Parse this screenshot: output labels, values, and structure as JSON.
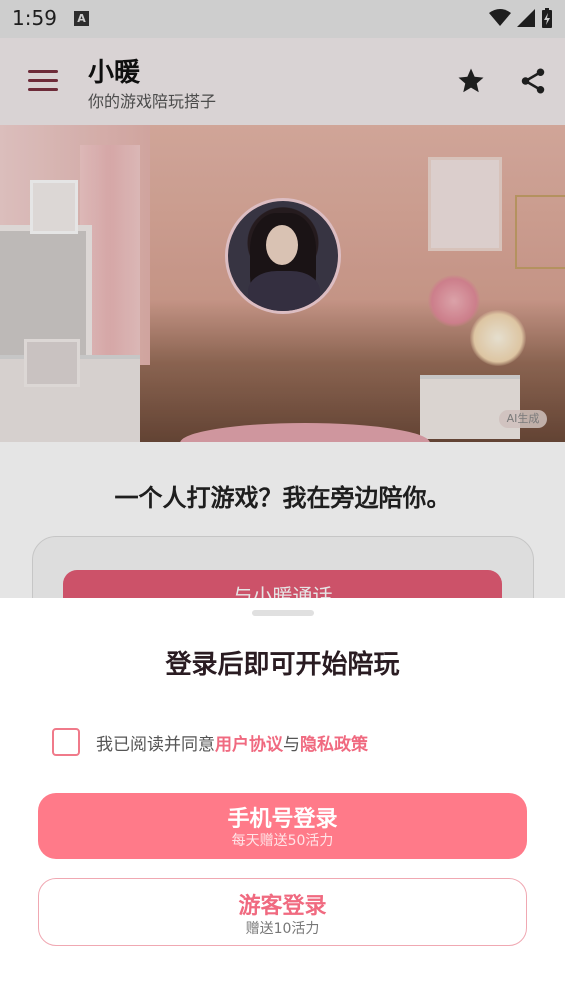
{
  "status_bar": {
    "time": "1:59",
    "notification_icon": "A"
  },
  "app_bar": {
    "title": "小暖",
    "subtitle": "你的游戏陪玩搭子"
  },
  "hero": {
    "ai_badge": "AI生成"
  },
  "main": {
    "headline": "一个人打游戏？我在旁边陪你。",
    "call_button_label": "与小暖通话"
  },
  "login_sheet": {
    "title": "登录后即可开始陪玩",
    "agreement": {
      "prefix": "我已阅读并同意",
      "user_agreement": "用户协议",
      "and": "与",
      "privacy_policy": "隐私政策",
      "checked": false
    },
    "phone_login": {
      "label": "手机号登录",
      "sublabel": "每天赠送50活力"
    },
    "guest_login": {
      "label": "游客登录",
      "sublabel": "赠送10活力"
    }
  },
  "colors": {
    "accent": "#ff7a89",
    "link": "#f06a80",
    "dark_accent": "#7a3040"
  }
}
